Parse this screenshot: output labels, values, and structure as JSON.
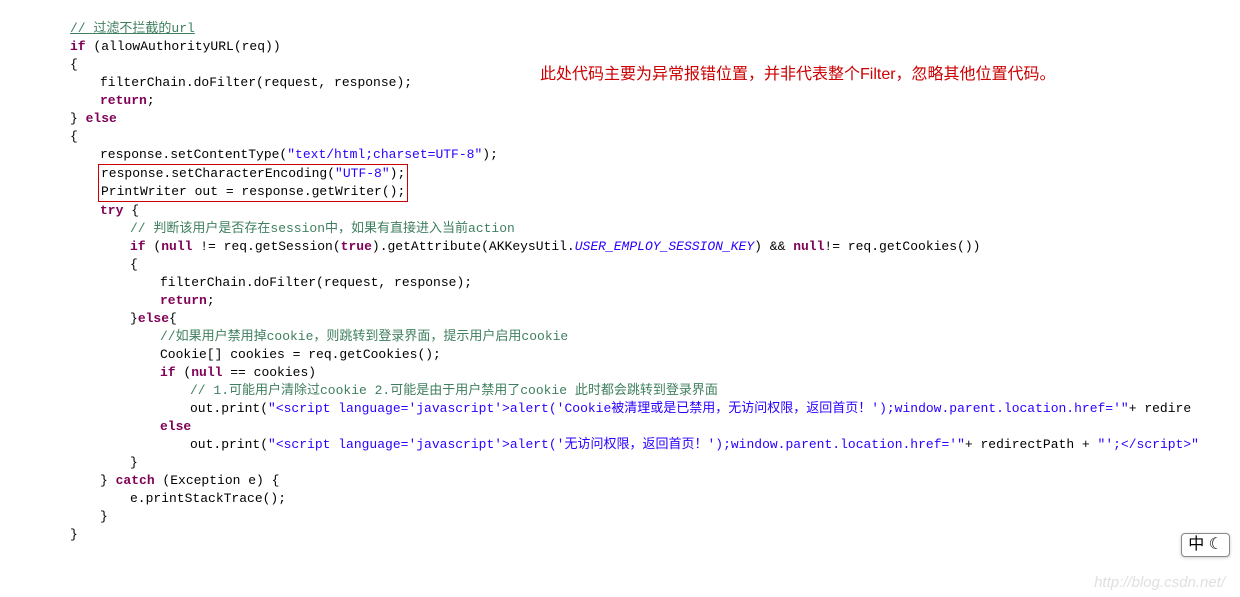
{
  "note": "此处代码主要为异常报错位置，并非代表整个Filter，忽略其他位置代码。",
  "c": {
    "l1": "// 过滤不拦截的url",
    "l2a": "if",
    "l2b": " (allowAuthorityURL(req))",
    "l3": "{",
    "l4": "filterChain.doFilter(request, response);",
    "l5": "return",
    "l5b": ";",
    "l6a": "} ",
    "l6b": "else",
    "l7": "{",
    "l8a": "response.setContentType(",
    "l8b": "\"text/html;charset=UTF-8\"",
    "l8c": ");",
    "l9a": "response.setCharacterEncoding(",
    "l9b": "\"UTF-8\"",
    "l9c": ");",
    "l10": "PrintWriter out = response.getWriter();",
    "l11a": "try",
    "l11b": " {",
    "l12": "// 判断该用户是否存在session中，如果有直接进入当前action",
    "l13a": "if",
    "l13b": " (",
    "l13c": "null",
    "l13d": " != req.getSession(",
    "l13e": "true",
    "l13f": ").getAttribute(AKKeysUtil.",
    "l13g": "USER_EMPLOY_SESSION_KEY",
    "l13h": ") && ",
    "l13i": "null",
    "l13j": "!= req.getCookies())",
    "l14": "{",
    "l15": "filterChain.doFilter(request, response);",
    "l16a": "return",
    "l16b": ";",
    "l17a": "}",
    "l17b": "else",
    "l17c": "{",
    "l18": "",
    "l19": "//如果用户禁用掉cookie，则跳转到登录界面，提示用户启用cookie",
    "l20": "Cookie[] cookies = req.getCookies();",
    "l21a": "if",
    "l21b": " (",
    "l21c": "null",
    "l21d": " == cookies)",
    "l22": "// 1.可能用户清除过cookie 2.可能是由于用户禁用了cookie 此时都会跳转到登录界面",
    "l23a": "out.print(",
    "l23b": "\"<script language='javascript'>alert('Cookie被清理或是已禁用，无访问权限，返回首页！');window.parent.location.href='\"",
    "l23c": "+ redire",
    "l24": "else",
    "l25a": "out.print(",
    "l25b": "\"<script language='javascript'>alert('无访问权限，返回首页！');window.parent.location.href='\"",
    "l25c": "+ redirectPath + ",
    "l25d": "\"';</scri",
    "l25e": "pt>\"",
    "l26": "}",
    "l27a": "} ",
    "l27b": "catch",
    "l27c": " (Exception e) {",
    "l28": "e.printStackTrace();",
    "l29": "}",
    "l30": "}"
  },
  "watermark": "http://blog.csdn.net/",
  "ime": "中 ☾"
}
